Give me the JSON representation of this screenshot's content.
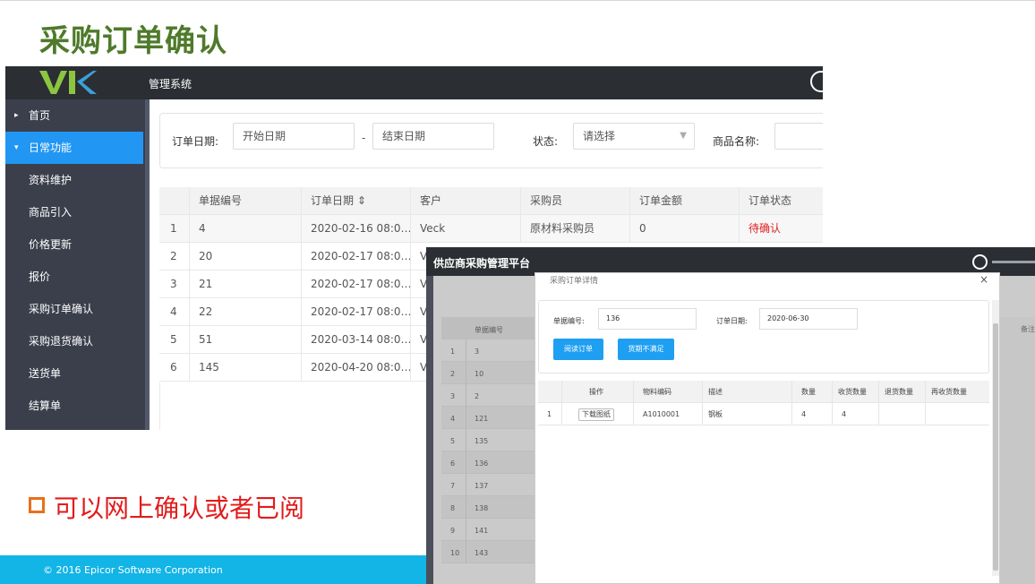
{
  "slide": {
    "title": "采购订单确认",
    "bullet": "可以网上确认或者已阅",
    "footer": "© 2016 Epicor Software Corporation"
  },
  "screen1": {
    "app_title": "管理系统",
    "sidebar": [
      {
        "label": "首页",
        "arrow": "▸"
      },
      {
        "label": "日常功能",
        "arrow": "▾"
      },
      {
        "label": "资料维护"
      },
      {
        "label": "商品引入"
      },
      {
        "label": "价格更新"
      },
      {
        "label": "报价"
      },
      {
        "label": "采购订单确认"
      },
      {
        "label": "采购退货确认"
      },
      {
        "label": "送货单"
      },
      {
        "label": "结算单"
      }
    ],
    "filters": {
      "order_date_label": "订单日期:",
      "start_placeholder": "开始日期",
      "dash": "-",
      "end_placeholder": "结束日期",
      "status_label": "状态:",
      "status_value": "请选择",
      "product_label": "商品名称:"
    },
    "table": {
      "headers": [
        "",
        "单据编号",
        "订单日期 ⇕",
        "客户",
        "采购员",
        "订单金额",
        "订单状态"
      ],
      "rows": [
        [
          "1",
          "4",
          "2020-02-16 08:0…",
          "Veck",
          "原材料采购员",
          "0",
          "待确认"
        ],
        [
          "2",
          "20",
          "2020-02-17 08:0…",
          "V"
        ],
        [
          "3",
          "21",
          "2020-02-17 08:0…",
          "V"
        ],
        [
          "4",
          "22",
          "2020-02-17 08:0…",
          "V"
        ],
        [
          "5",
          "51",
          "2020-03-14 08:0…",
          "V"
        ],
        [
          "6",
          "145",
          "2020-04-20 08:0…",
          "V"
        ]
      ]
    }
  },
  "screen2": {
    "app_title": "供应商采购管理平台",
    "bg_header": "单据编号",
    "bg_right_label": "备注",
    "bg_rows": [
      [
        "1",
        "3"
      ],
      [
        "2",
        "10"
      ],
      [
        "3",
        "2"
      ],
      [
        "4",
        "121"
      ],
      [
        "5",
        "135"
      ],
      [
        "6",
        "136"
      ],
      [
        "7",
        "137"
      ],
      [
        "8",
        "138"
      ],
      [
        "9",
        "141"
      ],
      [
        "10",
        "143"
      ]
    ],
    "modal": {
      "title": "采购订单详情",
      "close": "×",
      "doc_no_label": "单据编号:",
      "doc_no_value": "136",
      "order_date_label": "订单日期:",
      "order_date_value": "2020-06-30",
      "btn_read": "阅读订单",
      "btn_short": "货期不满足",
      "headers": [
        "",
        "操作",
        "物料编码",
        "描述",
        "数量",
        "收货数量",
        "退货数量",
        "再收货数量"
      ],
      "rows": [
        {
          "idx": "1",
          "action": "下载图纸",
          "code": "A1010001",
          "desc": "钢板",
          "qty": "4",
          "recv": "4",
          "ret": "",
          "rerecv": ""
        }
      ]
    }
  },
  "colors": {
    "title_green": "#4e7a2a",
    "sidebar_active": "#2196f3",
    "status_red": "#e02020",
    "button_blue": "#1e9ff2",
    "footer_blue": "#13b4e6",
    "bullet_orange": "#e8701a",
    "bullet_text_red": "#e21b1b"
  }
}
